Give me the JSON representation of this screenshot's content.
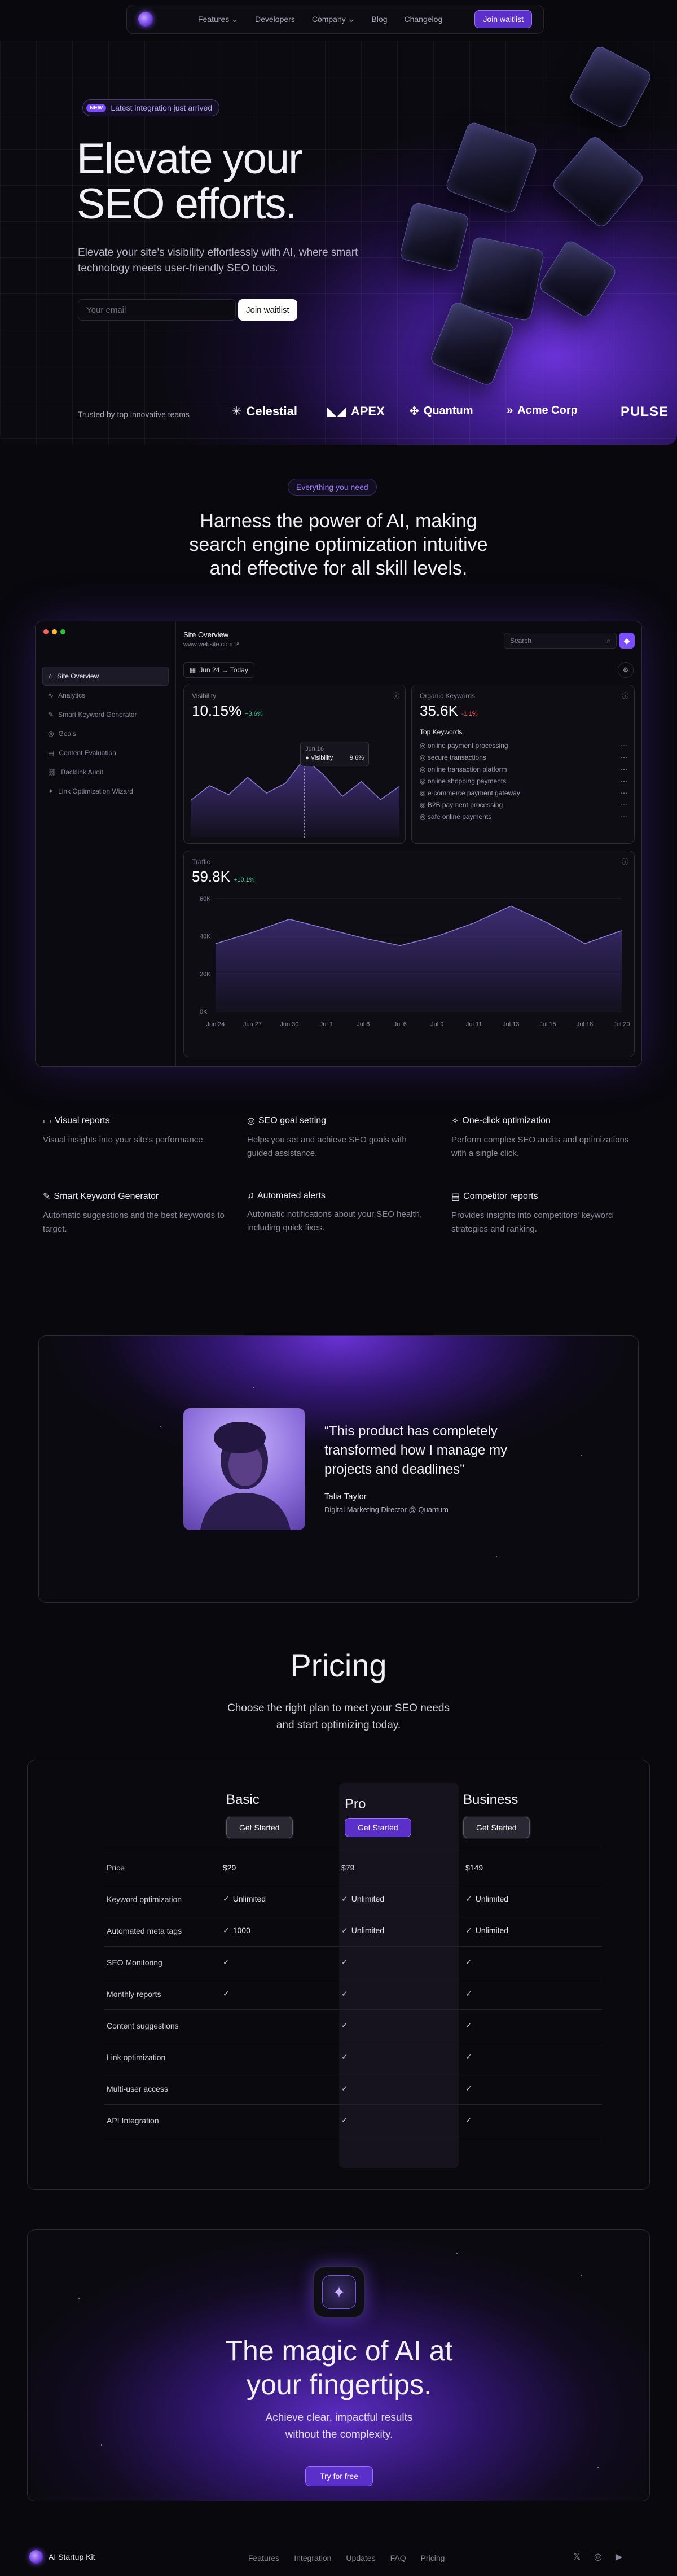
{
  "nav": {
    "items": [
      {
        "label": "Features",
        "dropdown": true
      },
      {
        "label": "Developers",
        "dropdown": false
      },
      {
        "label": "Company",
        "dropdown": true
      },
      {
        "label": "Blog",
        "dropdown": false
      },
      {
        "label": "Changelog",
        "dropdown": false
      }
    ],
    "cta": "Join waitlist"
  },
  "hero": {
    "badge_new": "NEW",
    "badge_text": "Latest integration just arrived",
    "title_line1": "Elevate your",
    "title_line2": "SEO efforts.",
    "subtitle": "Elevate your site's visibility effortlessly with AI, where smart technology meets user-friendly SEO tools.",
    "email_placeholder": "Your email",
    "cta": "Join waitlist",
    "trusted_label": "Trusted by top innovative teams",
    "brands": [
      "Celestial",
      "APEX",
      "Quantum",
      "Acme Corp",
      "PULSE"
    ]
  },
  "features_intro": {
    "chip": "Everything you need",
    "headline": "Harness the power of AI, making search engine optimization intuitive and effective for all skill levels."
  },
  "dashboard": {
    "site_title": "Site Overview",
    "site_url": "www.website.com",
    "search_placeholder": "Search",
    "date_range": "Jun 24 → Today",
    "sidebar": [
      {
        "label": "Site Overview",
        "active": true
      },
      {
        "label": "Analytics",
        "active": false
      },
      {
        "label": "Smart Keyword Generator",
        "active": false
      },
      {
        "label": "Goals",
        "active": false
      },
      {
        "label": "Content Evaluation",
        "active": false
      },
      {
        "label": "Backlink Audit",
        "active": false
      },
      {
        "label": "Link Optimization Wizard",
        "active": false
      }
    ],
    "visibility": {
      "label": "Visibility",
      "value": "10.15%",
      "delta": "+3.6%",
      "tooltip_date": "Jun 16",
      "tooltip_label": "Visibility",
      "tooltip_value": "9.6%"
    },
    "keywords": {
      "label": "Organic Keywords",
      "value": "35.6K",
      "delta": "-1.1%",
      "top_title": "Top Keywords",
      "items": [
        "online payment processing",
        "secure transactions",
        "online transaction platform",
        "online shopping payments",
        "e-commerce payment gateway",
        "B2B payment processing",
        "safe online payments"
      ]
    },
    "traffic": {
      "label": "Traffic",
      "value": "59.8K",
      "delta": "+10.1%",
      "y_ticks": [
        "60K",
        "40K",
        "20K",
        "0K"
      ],
      "x_ticks": [
        "Jun 24",
        "Jun 27",
        "Jun 30",
        "Jul 1",
        "Jul 6",
        "Jul 6",
        "Jul 9",
        "Jul 11",
        "Jul 13",
        "Jul 15",
        "Jul 18",
        "Jul 20"
      ]
    }
  },
  "chart_data": [
    {
      "type": "area",
      "title": "Visibility",
      "x": [
        "1",
        "2",
        "3",
        "4",
        "5",
        "6",
        "7",
        "8",
        "9",
        "10",
        "11",
        "12"
      ],
      "values": [
        4.5,
        6.3,
        5.2,
        7.3,
        5.4,
        6.6,
        9.6,
        7.6,
        5.0,
        6.8,
        4.6,
        6.2
      ],
      "ylim": [
        0,
        13
      ]
    },
    {
      "type": "area",
      "title": "Traffic",
      "x": [
        "Jun 24",
        "Jun 27",
        "Jun 30",
        "Jul 1",
        "Jul 6",
        "Jul 6",
        "Jul 9",
        "Jul 11",
        "Jul 13",
        "Jul 15",
        "Jul 18",
        "Jul 20"
      ],
      "values": [
        36,
        42,
        49,
        44,
        39,
        35,
        40,
        47,
        56,
        47,
        36,
        43
      ],
      "ylim": [
        0,
        60
      ]
    }
  ],
  "features": [
    {
      "icon": "bar-chart-icon",
      "title": "Visual reports",
      "text": "Visual insights into your site's performance."
    },
    {
      "icon": "target-icon",
      "title": "SEO goal setting",
      "text": "Helps you set and achieve SEO goals with guided assistance."
    },
    {
      "icon": "magic-icon",
      "title": "One-click optimization",
      "text": "Perform complex SEO audits and optimizations with a single click."
    },
    {
      "icon": "wand-icon",
      "title": "Smart Keyword Generator",
      "text": "Automatic suggestions and the best keywords to target."
    },
    {
      "icon": "bell-icon",
      "title": "Automated alerts",
      "text": "Automatic notifications about your SEO health, including quick fixes."
    },
    {
      "icon": "report-icon",
      "title": "Competitor reports",
      "text": "Provides insights into competitors' keyword strategies and ranking."
    }
  ],
  "testimonial": {
    "quote": "“This product has completely transformed how I manage my projects and deadlines”",
    "name": "Talia Taylor",
    "role": "Digital Marketing Director @ Quantum"
  },
  "pricing": {
    "title": "Pricing",
    "subtitle": "Choose the right plan to meet your SEO needs and start optimizing today.",
    "plans": [
      {
        "name": "Basic",
        "cta": "Get Started"
      },
      {
        "name": "Pro",
        "cta": "Get Started"
      },
      {
        "name": "Business",
        "cta": "Get Started"
      }
    ],
    "rows": [
      {
        "label": "Price",
        "basic": "$29",
        "pro": "$79",
        "business": "$149",
        "basic_check": false,
        "pro_check": false,
        "business_check": false
      },
      {
        "label": "Keyword optimization",
        "basic": "Unlimited",
        "pro": "Unlimited",
        "business": "Unlimited",
        "basic_check": true,
        "pro_check": true,
        "business_check": true
      },
      {
        "label": "Automated meta tags",
        "basic": "1000",
        "pro": "Unlimited",
        "business": "Unlimited",
        "basic_check": true,
        "pro_check": true,
        "business_check": true
      },
      {
        "label": "SEO Monitoring",
        "basic": "",
        "pro": "",
        "business": "",
        "basic_check": true,
        "pro_check": true,
        "business_check": true
      },
      {
        "label": "Monthly reports",
        "basic": "",
        "pro": "",
        "business": "",
        "basic_check": true,
        "pro_check": true,
        "business_check": true
      },
      {
        "label": "Content suggestions",
        "basic": "",
        "pro": "",
        "business": "",
        "basic_check": false,
        "pro_check": true,
        "business_check": true
      },
      {
        "label": "Link optimization",
        "basic": "",
        "pro": "",
        "business": "",
        "basic_check": false,
        "pro_check": true,
        "business_check": true
      },
      {
        "label": "Multi-user access",
        "basic": "",
        "pro": "",
        "business": "",
        "basic_check": false,
        "pro_check": true,
        "business_check": true
      },
      {
        "label": "API Integration",
        "basic": "",
        "pro": "",
        "business": "",
        "basic_check": false,
        "pro_check": true,
        "business_check": true
      }
    ]
  },
  "cta": {
    "title_line1": "The magic of AI at",
    "title_line2": "your fingertips.",
    "subtitle_line1": "Achieve clear, impactful results",
    "subtitle_line2": "without the complexity.",
    "button": "Try for free"
  },
  "footer": {
    "brand": "AI Startup Kit",
    "links": [
      "Features",
      "Integration",
      "Updates",
      "FAQ",
      "Pricing"
    ],
    "social": [
      "x-icon",
      "github-icon",
      "youtube-icon"
    ]
  },
  "colors": {
    "accent": "#7b4dff",
    "accent_dark": "#5b2fc9",
    "positive": "#3ecf8e",
    "negative": "#ff5a5a",
    "background": "#09080d"
  }
}
